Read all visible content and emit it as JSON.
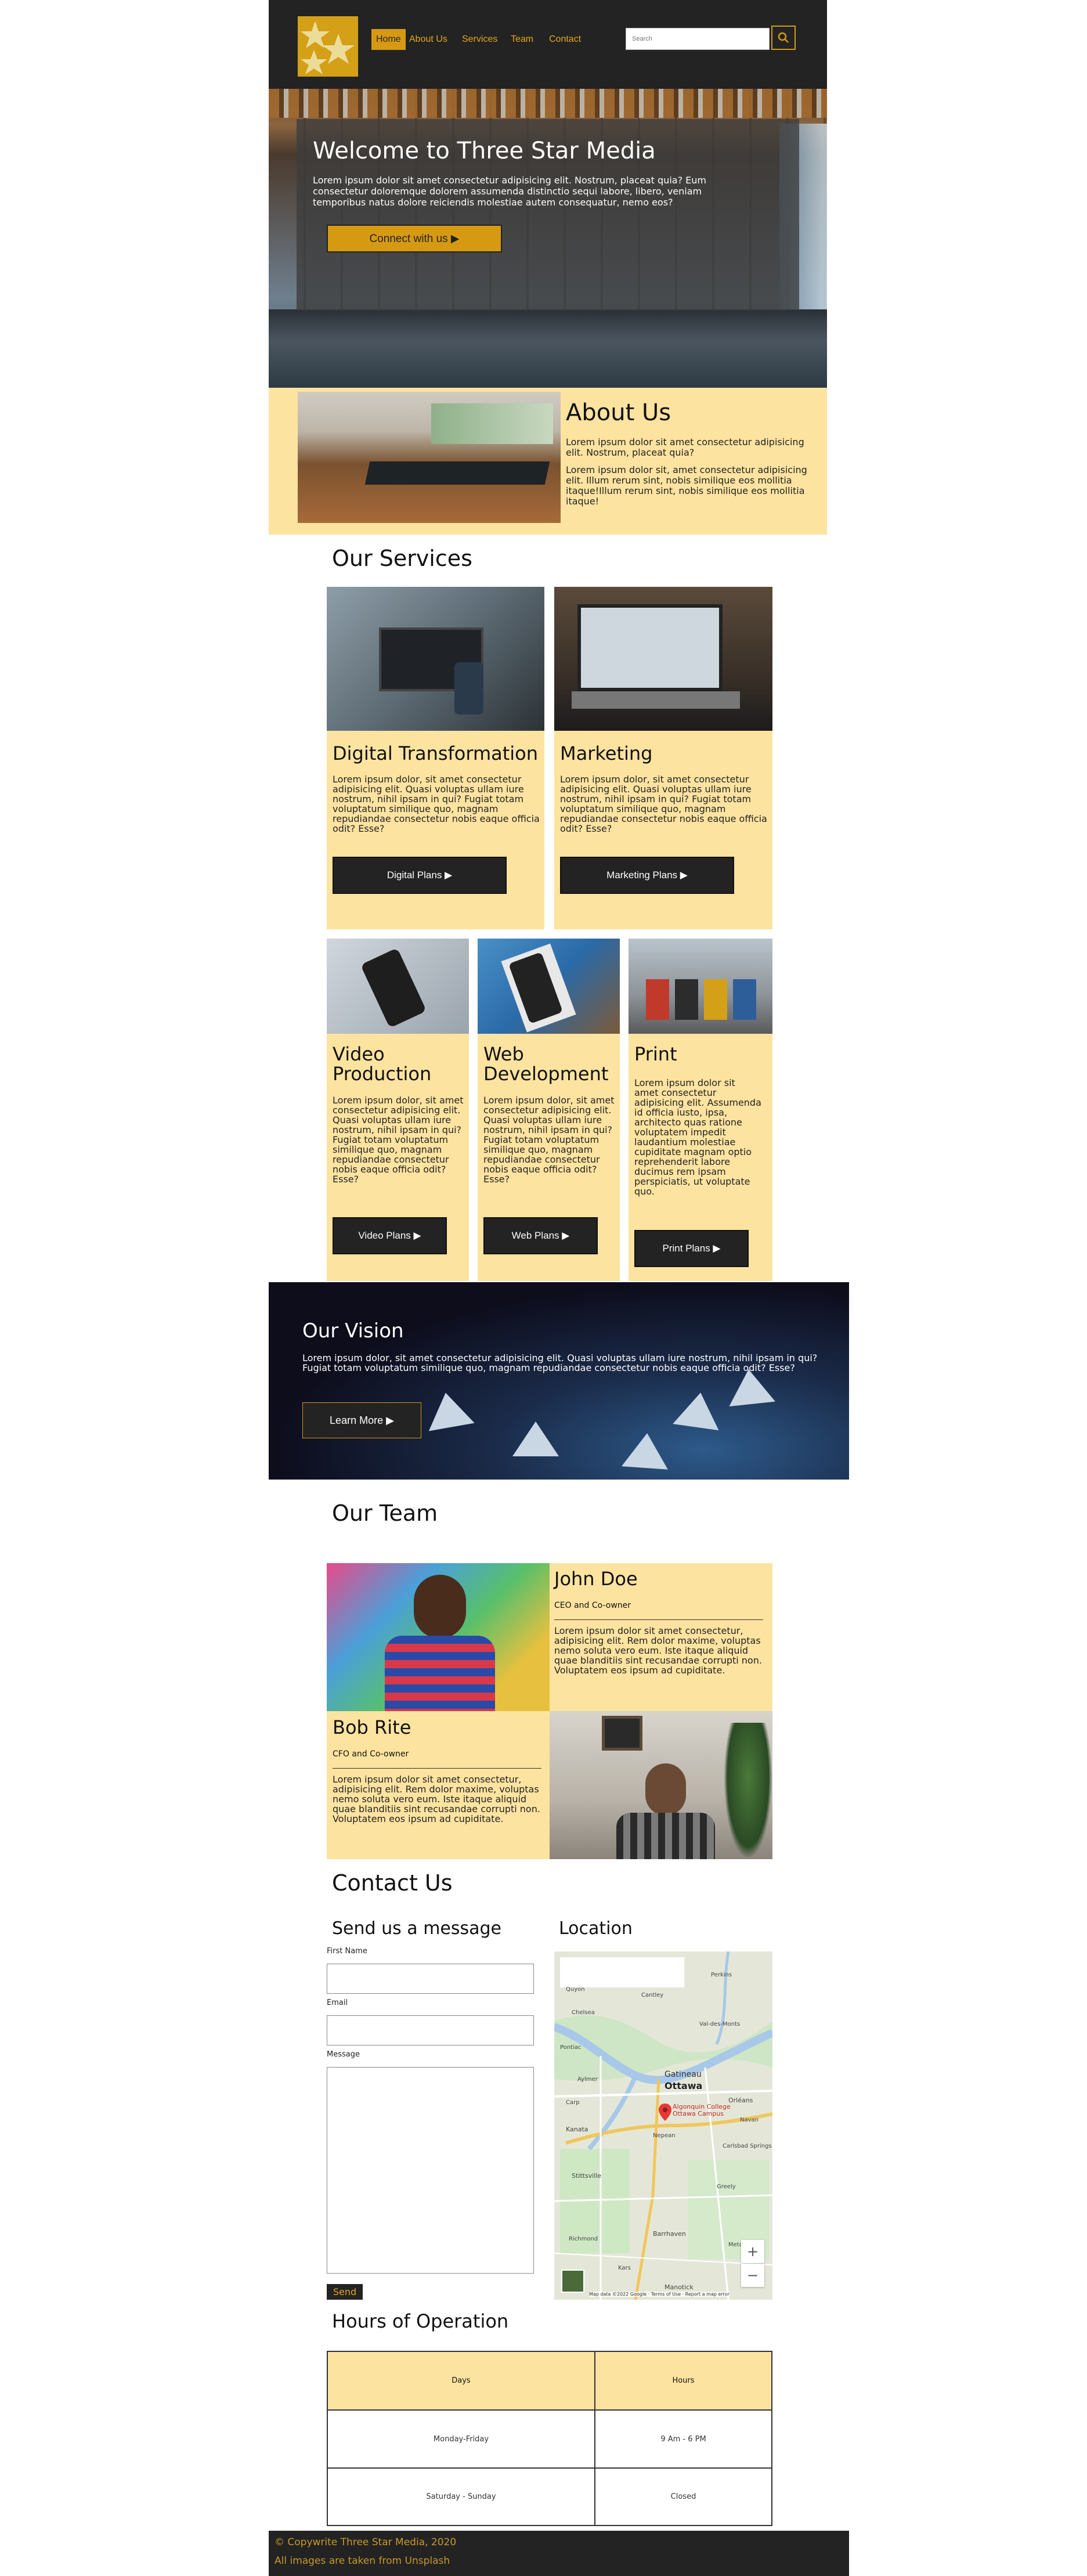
{
  "nav": {
    "items": [
      "Home",
      "About Us",
      "Services",
      "Team",
      "Contact"
    ],
    "search_placeholder": "Search",
    "search_icon": "search-icon",
    "logo_icon": "three-stars-logo"
  },
  "hero": {
    "title": "Welcome to Three Star Media",
    "text": "Lorem ipsum dolor sit amet consectetur adipisicing elit. Nostrum, placeat quia? Eum consectetur doloremque dolorem assumenda distinctio sequi labore, libero, veniam temporibus natus dolore reiciendis molestiae autem consequatur, nemo eos?",
    "button": "Connect with us ▶"
  },
  "about": {
    "title": "About Us",
    "p1": "Lorem ipsum dolor sit amet consectetur adipisicing elit. Nostrum, placeat quia?",
    "p2": "Lorem ipsum dolor sit, amet consectetur adipisicing elit. Illum rerum sint, nobis similique eos mollitia itaque!Illum rerum sint, nobis similique eos mollitia itaque!"
  },
  "services": {
    "title": "Our Services",
    "cards": [
      {
        "title": "Digital Transformation",
        "text": "Lorem ipsum dolor, sit amet consectetur adipisicing elit. Quasi voluptas ullam iure nostrum, nihil ipsam in qui? Fugiat totam voluptatum similique quo, magnam repudiandae consectetur nobis eaque officia odit? Esse?",
        "button": "Digital Plans ▶"
      },
      {
        "title": "Marketing",
        "text": "Lorem ipsum dolor, sit amet consectetur adipisicing elit. Quasi voluptas ullam iure nostrum, nihil ipsam in qui? Fugiat totam voluptatum similique quo, magnam repudiandae consectetur nobis eaque officia odit? Esse?",
        "button": "Marketing Plans ▶"
      },
      {
        "title": "Video Production",
        "text": "Lorem ipsum dolor, sit amet consectetur adipisicing elit. Quasi voluptas ullam iure nostrum, nihil ipsam in qui? Fugiat totam voluptatum similique quo, magnam repudiandae consectetur nobis eaque officia odit? Esse?",
        "button": "Video Plans ▶"
      },
      {
        "title": "Web Development",
        "text": "Lorem ipsum dolor, sit amet consectetur adipisicing elit. Quasi voluptas ullam iure nostrum, nihil ipsam in qui? Fugiat totam voluptatum similique quo, magnam repudiandae consectetur nobis eaque officia odit? Esse?",
        "button": "Web Plans ▶"
      },
      {
        "title": "Print",
        "text": "Lorem ipsum dolor sit amet consectetur adipisicing elit. Assumenda id officia iusto, ipsa, architecto quas ratione voluptatem impedit laudantium molestiae cupiditate magnam optio reprehenderit labore ducimus rem ipsam perspiciatis, ut voluptate quo.",
        "button": "Print Plans ▶"
      }
    ]
  },
  "vision": {
    "title": "Our Vision",
    "text": "Lorem ipsum dolor, sit amet consectetur adipisicing elit. Quasi voluptas ullam iure nostrum, nihil ipsam in qui? Fugiat totam voluptatum similique quo, magnam repudiandae consectetur nobis eaque officia odit? Esse?",
    "button": "Learn More ▶"
  },
  "team": {
    "title": "Our Team",
    "members": [
      {
        "name": "John Doe",
        "role": "CEO and Co-owner",
        "bio": "Lorem ipsum dolor sit amet consectetur, adipisicing elit. Rem dolor maxime, voluptas nemo soluta vero eum. Iste itaque aliquid quae blanditiis sint recusandae corrupti non. Voluptatem eos ipsum ad cupiditate."
      },
      {
        "name": "Bob Rite",
        "role": "CFO and Co-owner",
        "bio": "Lorem ipsum dolor sit amet consectetur, adipisicing elit. Rem dolor maxime, voluptas nemo soluta vero eum. Iste itaque aliquid quae blanditiis sint recusandae corrupti non. Voluptatem eos ipsum ad cupiditate."
      }
    ]
  },
  "contact": {
    "title": "Contact Us",
    "form_title": "Send us a message",
    "first_name_label": "First Name",
    "email_label": "Email",
    "message_label": "Message",
    "send": "Send",
    "location_title": "Location",
    "map": {
      "cities": [
        "Ottawa",
        "Gatineau",
        "Orléans",
        "Kanata",
        "Nepean",
        "Stittsville",
        "Barrhaven",
        "Manotick",
        "Chelsea",
        "Pontiac",
        "Aylmer",
        "Cantley",
        "Val-des-Monts",
        "Quyon",
        "Perkins",
        "Kars",
        "Metcalfe",
        "Greely",
        "Richmond",
        "Carp",
        "Carlsbad Springs",
        "Navan"
      ],
      "marker_label": "Algonquin College Ottawa Campus",
      "footer": "Map data ©2022 Google · Terms of Use · Report a map error",
      "zoom_in": "+",
      "zoom_out": "−"
    }
  },
  "hours": {
    "title": "Hours of Operation",
    "headers": [
      "Days",
      "Hours"
    ],
    "rows": [
      [
        "Monday-Friday",
        "9 Am - 6 PM"
      ],
      [
        "Saturday - Sunday",
        "Closed"
      ]
    ]
  },
  "footer": {
    "line1": "© Copywrite Three Star Media, 2020",
    "line2": "All images are taken from Unsplash"
  },
  "colors": {
    "accent": "#d69a12",
    "dark": "#232323",
    "cream": "#fde3a0"
  }
}
